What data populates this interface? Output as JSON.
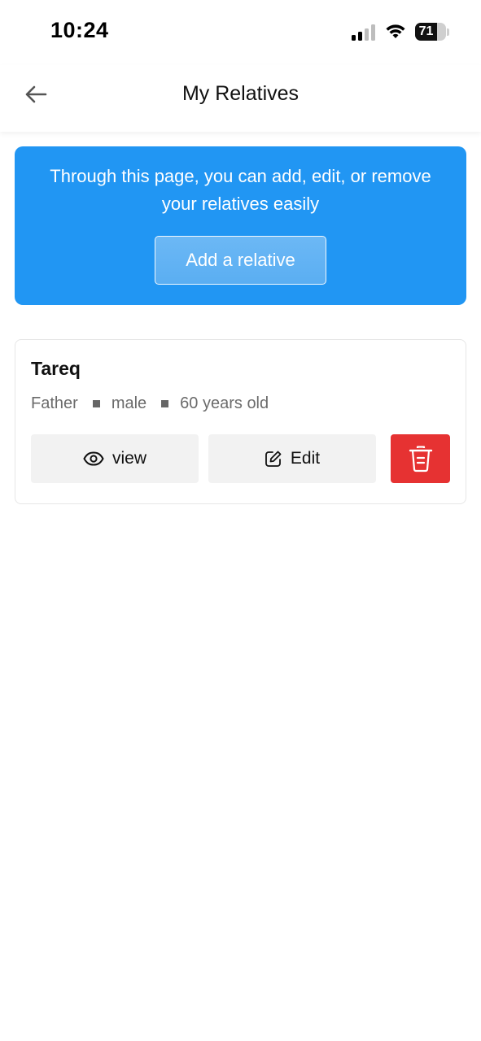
{
  "status_bar": {
    "time": "10:24",
    "battery_level": "71",
    "battery_fraction": 0.71
  },
  "header": {
    "title": "My Relatives",
    "back_icon": "arrow-left-icon"
  },
  "banner": {
    "text": "Through this page, you can add, edit, or remove your relatives easily",
    "add_button_label": "Add a relative",
    "color": "#2196f3"
  },
  "relatives": [
    {
      "name": "Tareq",
      "relation": "Father",
      "gender": "male",
      "age": "60 years old",
      "view_label": "view",
      "edit_label": "Edit",
      "view_icon": "eye-icon",
      "edit_icon": "edit-icon",
      "delete_icon": "trash-icon"
    }
  ],
  "colors": {
    "delete": "#e63232",
    "button_bg": "#f2f2f2"
  }
}
